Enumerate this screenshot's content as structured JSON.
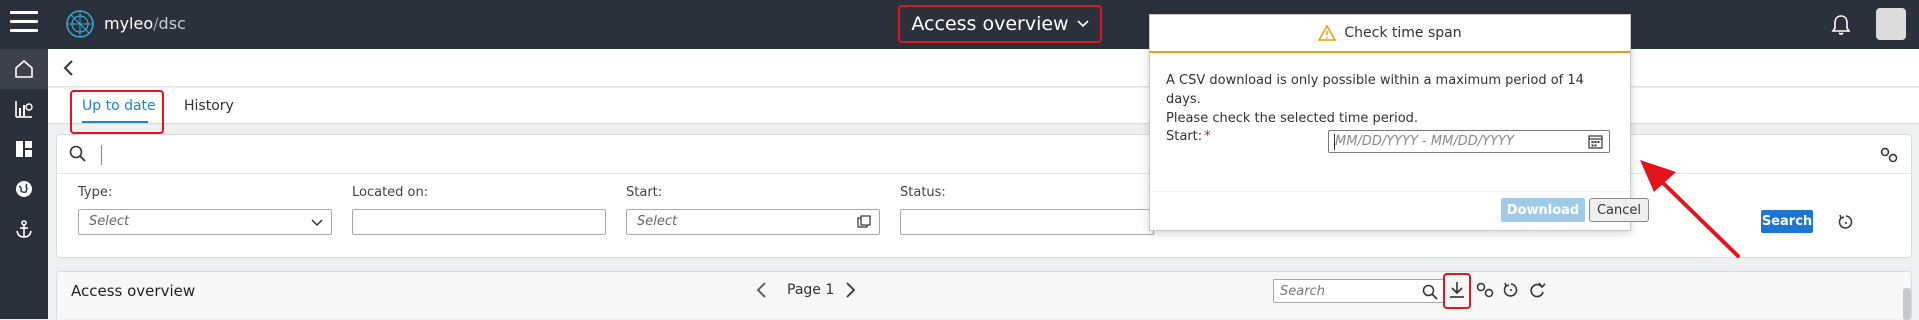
{
  "app": {
    "brand": "myleo",
    "brand_sep": "/",
    "brand_sub": "dsc",
    "title": "Access overview"
  },
  "tabs": [
    {
      "label": "Up to date",
      "active": true
    },
    {
      "label": "History",
      "active": false
    }
  ],
  "filters": {
    "type": {
      "label": "Type:",
      "value": "Select"
    },
    "located_on": {
      "label": "Located on:",
      "value": ""
    },
    "start": {
      "label": "Start:",
      "value": "Select"
    },
    "status": {
      "label": "Status:",
      "value": ""
    },
    "search_button": "Search"
  },
  "grid": {
    "title": "Access overview",
    "page_label": "Page 1",
    "search_placeholder": "Search"
  },
  "dialog": {
    "title": "Check time span",
    "message_line1": "A CSV download is only possible within a maximum period of 14 days.",
    "message_line2": "Please check the selected time period.",
    "start_label": "Start:",
    "required_mark": "*",
    "date_placeholder": "MM/DD/YYYY - MM/DD/YYYY",
    "download_label": "Download",
    "cancel_label": "Cancel"
  },
  "colors": {
    "accent": "#1c86d4",
    "highlight": "#e3141c",
    "warning": "#f29b1c",
    "topbar": "#2b313a"
  }
}
